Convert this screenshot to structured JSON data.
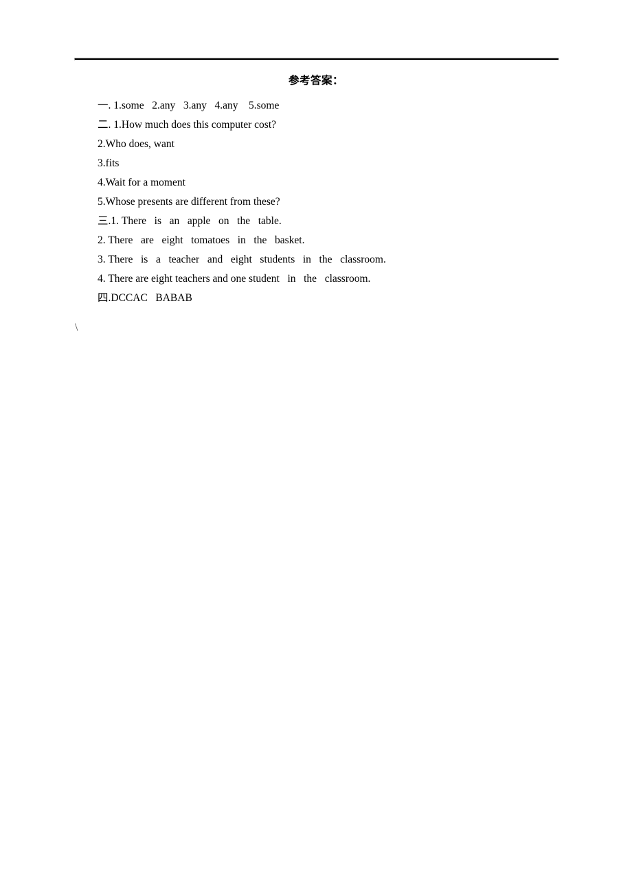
{
  "document": {
    "title": "参考答案：",
    "header_rule": true,
    "stray_mark": "\\"
  },
  "answers": [
    {
      "id": "section-1-line-1",
      "text": "一. 1.some   2.any   3.any   4.any    5.some"
    },
    {
      "id": "section-2-line-1",
      "text": "二. 1.How much does this computer cost?"
    },
    {
      "id": "section-2-line-2",
      "text": "2.Who does, want"
    },
    {
      "id": "section-2-line-3",
      "text": "3.fits"
    },
    {
      "id": "section-2-line-4",
      "text": "4.Wait for a moment"
    },
    {
      "id": "section-2-line-5",
      "text": "5.Whose presents are different from these?"
    },
    {
      "id": "section-3-line-1",
      "text": "三.1. There   is   an   apple   on   the   table."
    },
    {
      "id": "section-3-line-2",
      "text": "2. There   are   eight   tomatoes   in   the   basket."
    },
    {
      "id": "section-3-line-3",
      "text": "3. There   is   a   teacher   and   eight   students   in   the   classroom."
    },
    {
      "id": "section-3-line-4",
      "text": "4. There are eight teachers and one student   in   the   classroom."
    },
    {
      "id": "section-4-line-1",
      "text": "四.DCCAC   BABAB"
    }
  ]
}
